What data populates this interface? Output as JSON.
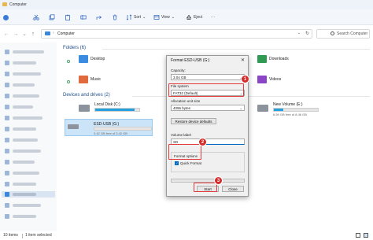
{
  "window": {
    "title": "Computer"
  },
  "toolbar": {
    "sort_label": "Sort",
    "view_label": "View",
    "eject_label": "Eject",
    "more_label": "···"
  },
  "address": {
    "crumb": "Computer",
    "search_placeholder": "Search Computer"
  },
  "sections": {
    "folders_title": "Folders (6)",
    "drives_title": "Devices and drives (2)"
  },
  "folders": [
    {
      "label": "Desktop",
      "icon": "desktop-folder-icon",
      "color": "#3b8be0"
    },
    {
      "label": "Music",
      "icon": "music-folder-icon",
      "color": "#e06a3b"
    },
    {
      "label": "Downloads",
      "icon": "downloads-folder-icon",
      "color": "#2f9b52"
    },
    {
      "label": "Videos",
      "icon": "videos-folder-icon",
      "color": "#8b46c8"
    }
  ],
  "drives": [
    {
      "name": "Local Disk (C:)",
      "size": "",
      "usage": 0.9,
      "selected": false
    },
    {
      "name": "ESD-USB (G:)",
      "size": "3.42 GB free of 3.42 GB",
      "usage": 0.0,
      "selected": true
    },
    {
      "name": "New Volume (E:)",
      "size": "6.59 GB free of 8.46 GB",
      "usage": 0.22,
      "selected": false
    }
  ],
  "status": {
    "items": "10 items",
    "selected": "1 item selected"
  },
  "dialog": {
    "title": "Format ESD-USB (G:)",
    "close": "✕",
    "capacity_label": "Capacity:",
    "capacity_value": "3.04 GB",
    "filesystem_label": "File system",
    "filesystem_value": "FAT32 (Default)",
    "allocation_label": "Allocation unit size",
    "allocation_value": "4096 bytes",
    "restore_button": "Restore device defaults",
    "volume_label": "Volume label",
    "volume_value": "SD",
    "format_options_label": "Format options",
    "quick_format_label": "Quick Format",
    "quick_format_checked": true,
    "start_button": "Start",
    "close_button": "Close"
  },
  "callouts": [
    "1",
    "2",
    "3"
  ],
  "colors": {
    "highlight": "#e23a3a",
    "accent": "#0067c0"
  }
}
